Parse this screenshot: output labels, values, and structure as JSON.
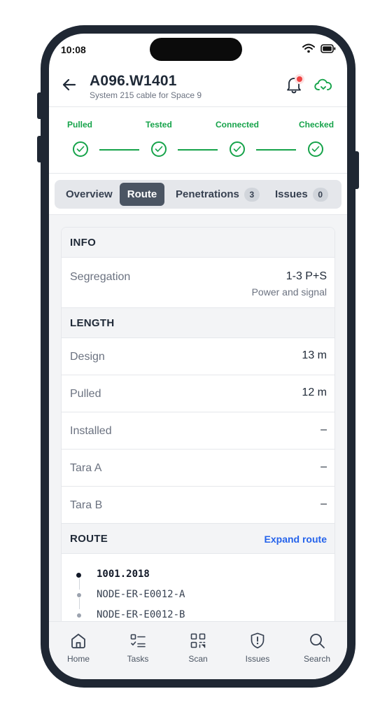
{
  "status_bar": {
    "time": "10:08",
    "icons": [
      "wifi-icon",
      "battery-icon"
    ]
  },
  "header": {
    "title": "A096.W1401",
    "subtitle": "System 215 cable for Space 9",
    "icons": [
      "back-arrow-icon",
      "bell-icon",
      "cloud-sync-icon"
    ],
    "has_notification": true
  },
  "progress": {
    "steps": [
      {
        "label": "Pulled",
        "done": true
      },
      {
        "label": "Tested",
        "done": true
      },
      {
        "label": "Connected",
        "done": true
      },
      {
        "label": "Checked",
        "done": true
      }
    ]
  },
  "tabs": [
    {
      "label": "Overview",
      "active": false,
      "badge": null
    },
    {
      "label": "Route",
      "active": true,
      "badge": null
    },
    {
      "label": "Penetrations",
      "active": false,
      "badge": "3"
    },
    {
      "label": "Issues",
      "active": false,
      "badge": "0"
    }
  ],
  "info": {
    "title": "INFO",
    "segregation": {
      "label": "Segregation",
      "value": "1-3 P+S",
      "sub": "Power and signal"
    }
  },
  "length": {
    "title": "LENGTH",
    "rows": [
      {
        "label": "Design",
        "value": "13 m"
      },
      {
        "label": "Pulled",
        "value": "12 m"
      },
      {
        "label": "Installed",
        "value": "–"
      },
      {
        "label": "Tara A",
        "value": "–"
      },
      {
        "label": "Tara B",
        "value": "–"
      }
    ]
  },
  "route": {
    "title": "ROUTE",
    "expand_label": "Expand route",
    "items": [
      "1001.2018",
      "NODE-ER-E0012-A",
      "NODE-ER-E0012-B"
    ]
  },
  "nav": [
    {
      "label": "Home",
      "icon": "home-icon"
    },
    {
      "label": "Tasks",
      "icon": "tasks-icon"
    },
    {
      "label": "Scan",
      "icon": "qr-scan-icon"
    },
    {
      "label": "Issues",
      "icon": "issues-shield-icon"
    },
    {
      "label": "Search",
      "icon": "search-icon"
    }
  ],
  "colors": {
    "success": "#16a34a",
    "accent": "#2563eb",
    "active_tab": "#4b5563",
    "frame": "#1f2733"
  }
}
